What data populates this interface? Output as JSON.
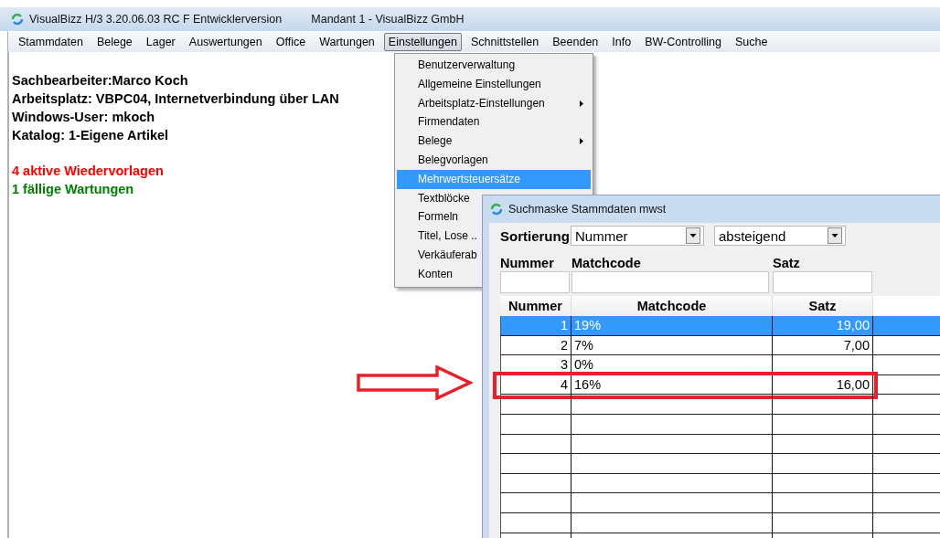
{
  "window": {
    "title": "VisualBizz H/3 3.20.06.03 RC F Entwicklerversion",
    "subtitle": "Mandant 1 - VisualBizz GmbH"
  },
  "menu_bar": [
    {
      "label": "Stammdaten",
      "selected": false
    },
    {
      "label": "Belege",
      "selected": false
    },
    {
      "label": "Lager",
      "selected": false
    },
    {
      "label": "Auswertungen",
      "selected": false
    },
    {
      "label": "Office",
      "selected": false
    },
    {
      "label": "Wartungen",
      "selected": false
    },
    {
      "label": "Einstellungen",
      "selected": true
    },
    {
      "label": "Schnittstellen",
      "selected": false
    },
    {
      "label": "Beenden",
      "selected": false
    },
    {
      "label": "Info",
      "selected": false
    },
    {
      "label": "BW-Controlling",
      "selected": false
    },
    {
      "label": "Suche",
      "selected": false
    }
  ],
  "open_menu": {
    "items": [
      {
        "label": "Benutzerverwaltung",
        "submenu": false,
        "selected": false
      },
      {
        "label": "Allgemeine Einstellungen",
        "submenu": false,
        "selected": false
      },
      {
        "label": "Arbeitsplatz-Einstellungen",
        "submenu": true,
        "selected": false
      },
      {
        "label": "Firmendaten",
        "submenu": false,
        "selected": false
      },
      {
        "label": "Belege",
        "submenu": true,
        "selected": false
      },
      {
        "label": "Belegvorlagen",
        "submenu": false,
        "selected": false
      },
      {
        "label": "Mehrwertsteuersätze",
        "submenu": false,
        "selected": true
      },
      {
        "label": "Textblöcke",
        "submenu": false,
        "selected": false
      },
      {
        "label": "Formeln",
        "submenu": false,
        "selected": false
      },
      {
        "label": "Titel, Lose ..",
        "submenu": false,
        "selected": false
      },
      {
        "label": "Verkäuferab",
        "submenu": false,
        "selected": false
      },
      {
        "label": "Konten",
        "submenu": false,
        "selected": false
      }
    ]
  },
  "info": {
    "lines": [
      "Sachbearbeiter:Marco Koch",
      "Arbeitsplatz: VBPC04, Internetverbindung über LAN",
      "Windows-User: mkoch",
      "Katalog: 1-Eigene Artikel"
    ],
    "alerts": [
      {
        "text": "4 aktive Wiedervorlagen",
        "color": "#ff0000"
      },
      {
        "text": "1 fällige Wartungen",
        "color": "#008000"
      }
    ]
  },
  "dialog": {
    "title": "Suchmaske Stammdaten mwst",
    "sort_label": "Sortierung",
    "sort_field": {
      "value": "Nummer"
    },
    "sort_order": {
      "value": "absteigend"
    },
    "filter_labels": [
      "Nummer",
      "Matchcode",
      "Satz"
    ],
    "table": {
      "columns": [
        "Nummer",
        "Matchcode",
        "Satz"
      ],
      "rows": [
        {
          "nummer": "1",
          "matchcode": "19%",
          "satz": "19,00",
          "selected": true,
          "highlighted": false
        },
        {
          "nummer": "2",
          "matchcode": "7%",
          "satz": "7,00",
          "selected": false,
          "highlighted": false
        },
        {
          "nummer": "3",
          "matchcode": "0%",
          "selected": false,
          "highlighted": false
        },
        {
          "nummer": "4",
          "matchcode": "16%",
          "satz": "16,00",
          "selected": false,
          "highlighted": true
        }
      ]
    }
  }
}
